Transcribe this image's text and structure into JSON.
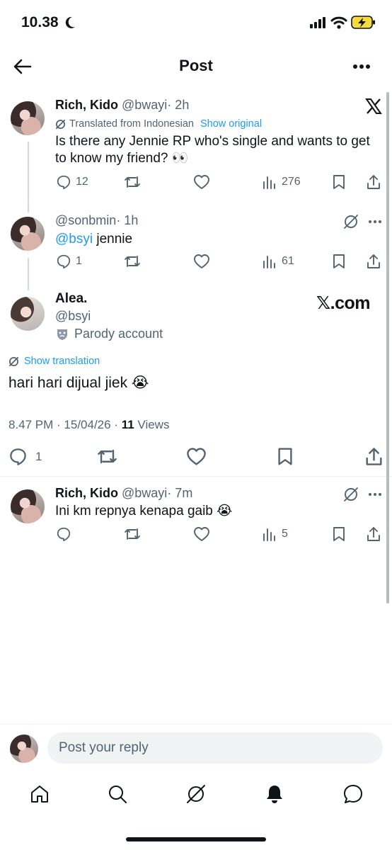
{
  "status_bar": {
    "time": "10.38"
  },
  "header": {
    "title": "Post"
  },
  "reply1": {
    "name": "Rich, Kido",
    "handle": "@bwayi",
    "time": "· 2h",
    "translated_label": "Translated from Indonesian",
    "show_original": "Show original",
    "text": "Is there any Jennie RP who's single and wants to get to know my friend? 👀",
    "replies": "12",
    "views": "276"
  },
  "reply2": {
    "handle": "@sonbmin",
    "time": "· 1h",
    "mention": "@bsyi",
    "text": " jennie",
    "replies": "1",
    "views": "61"
  },
  "main_post": {
    "name": "Alea.",
    "handle": "@bsyi",
    "parody_label": "Parody account",
    "watermark": "𝕏.com",
    "show_translation": "Show translation",
    "text": "hari hari dijual jiek 😭",
    "timestamp": "8.47 PM · 15/04/26 · ",
    "views_count": "11",
    "views_label": " Views",
    "replies": "1"
  },
  "reply3": {
    "name": "Rich, Kido",
    "handle": "@bwayi",
    "time": "· 7m",
    "text": "Ini km repnya kenapa gaib 😭",
    "views": "5"
  },
  "composer": {
    "placeholder": "Post your reply"
  },
  "colors": {
    "accent": "#1d9bf0",
    "muted": "#536471",
    "text": "#0f1419"
  }
}
